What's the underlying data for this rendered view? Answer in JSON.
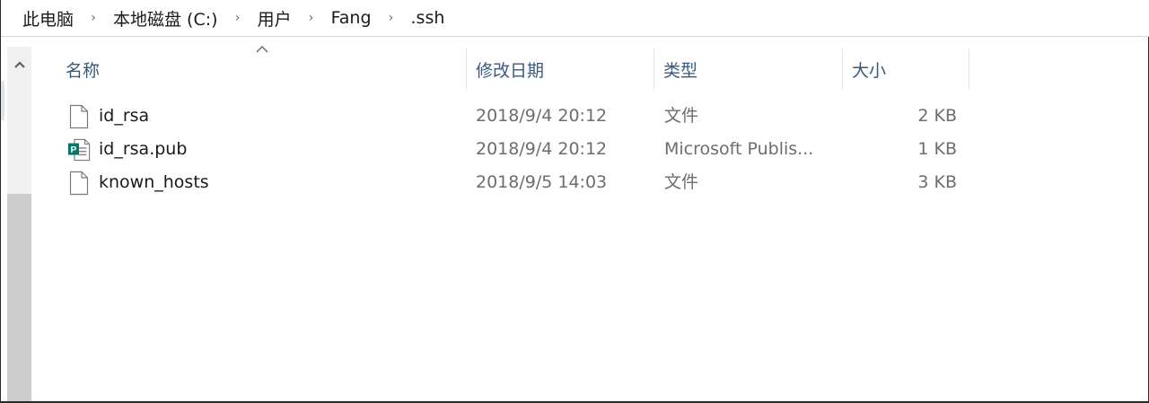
{
  "breadcrumb": {
    "items": [
      "此电脑",
      "本地磁盘 (C:)",
      "用户",
      "Fang",
      ".ssh"
    ],
    "separator": "›"
  },
  "header": {
    "name": "名称",
    "date": "修改日期",
    "type": "类型",
    "size": "大小",
    "sort_indicator": "ascending"
  },
  "files": [
    {
      "icon": "blank-file-icon",
      "name": "id_rsa",
      "date": "2018/9/4 20:12",
      "type": "文件",
      "size": "2 KB"
    },
    {
      "icon": "microsoft-publisher-file-icon",
      "name": "id_rsa.pub",
      "date": "2018/9/4 20:12",
      "type": "Microsoft Publis...",
      "size": "1 KB"
    },
    {
      "icon": "blank-file-icon",
      "name": "known_hosts",
      "date": "2018/9/5 14:03",
      "type": "文件",
      "size": "3 KB"
    }
  ],
  "colors": {
    "header_text": "#3a5a7d",
    "publisher_green": "#077568",
    "scrollbar_track": "#f0f0f0",
    "scrollbar_thumb": "#cdcdcd"
  }
}
